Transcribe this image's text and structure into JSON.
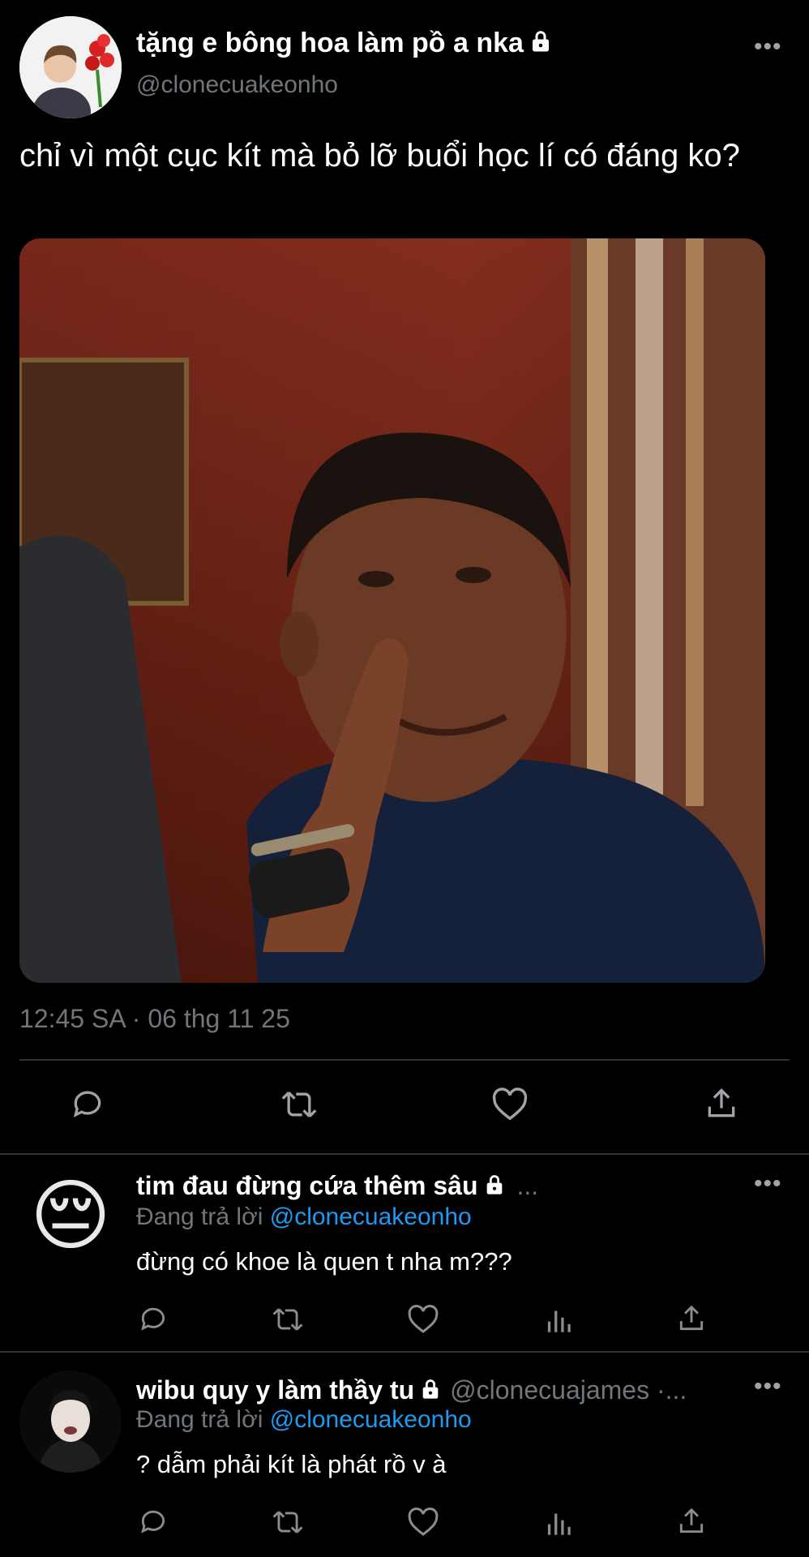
{
  "main_tweet": {
    "author_name": "tặng e bông hoa làm pồ a nka",
    "handle": "@clonecuakeonho",
    "text": "chỉ vì một cục kít mà bỏ lỡ buổi học lí có đáng ko?",
    "timestamp": "12:45 SA · 06 thg 11 25",
    "more": "•••",
    "actions": [
      "reply-icon",
      "retweet-icon",
      "like-icon",
      "share-icon"
    ]
  },
  "replies": [
    {
      "author_name": "tim đau đừng cứa thêm sâu",
      "ellipsis": "...",
      "replying_label": "Đang trả lời",
      "replying_to": "@clonecuakeonho",
      "text": "đừng có khoe là quen t nha m???",
      "more": "•••",
      "avatar_emoji": "😔",
      "actions": [
        "reply-icon",
        "retweet-icon",
        "like-icon",
        "views-icon",
        "share-icon"
      ]
    },
    {
      "author_name": "wibu quy y làm thầy tu",
      "handle": "@clonecuajames ·...",
      "replying_label": "Đang trả lời",
      "replying_to": "@clonecuakeonho",
      "text": "? dẫm phải kít là phát rồ v à",
      "more": "•••",
      "actions": [
        "reply-icon",
        "retweet-icon",
        "like-icon",
        "views-icon",
        "share-icon"
      ]
    }
  ],
  "colors": {
    "background": "#000000",
    "text": "#e7e9ea",
    "secondary": "#71767b",
    "link": "#1d9bf0",
    "divider": "#2f3336"
  }
}
